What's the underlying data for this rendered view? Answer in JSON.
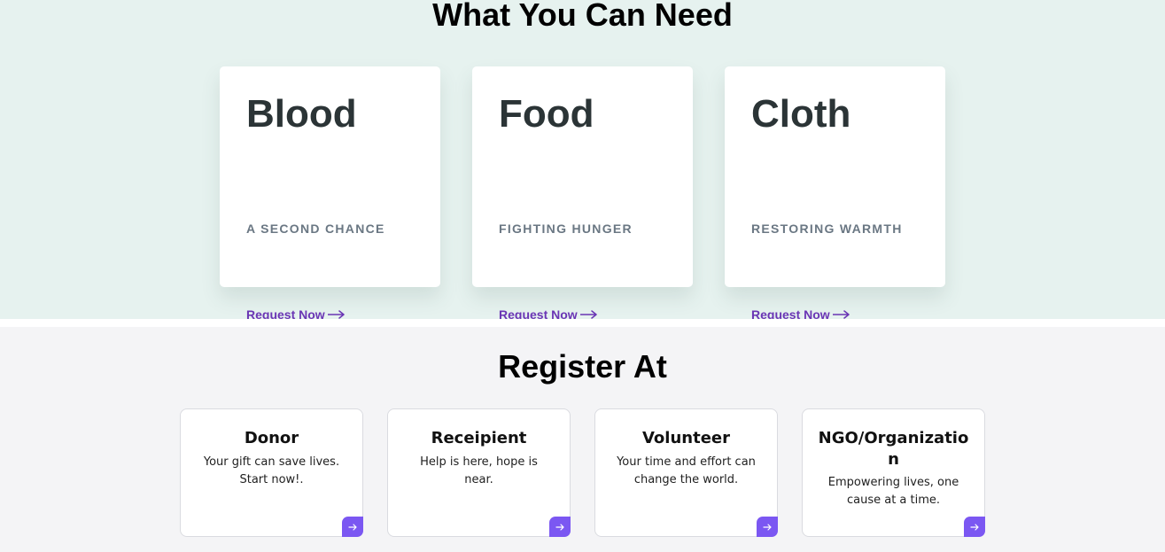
{
  "need_section": {
    "title": "What You Can Need",
    "background": "#e6f2ef",
    "cards": [
      {
        "heading": "Blood",
        "subtitle": "A SECOND CHANCE",
        "link": "Request Now",
        "link_icon": "long-arrow-right-icon"
      },
      {
        "heading": "Food",
        "subtitle": "FIGHTING HUNGER",
        "link": "Request Now",
        "link_icon": "long-arrow-right-icon"
      },
      {
        "heading": "Cloth",
        "subtitle": "RESTORING WARMTH",
        "link": "Request Now",
        "link_icon": "long-arrow-right-icon"
      }
    ],
    "link_color": "#6a35b4"
  },
  "register_section": {
    "title": "Register At",
    "background": "#f4f4f6",
    "button_color": "#7b57f2",
    "cards": [
      {
        "heading": "Donor",
        "text": "Your gift can save lives. Start now!.",
        "button_icon": "arrow-right-icon"
      },
      {
        "heading": "Receipient",
        "text": "Help is here, hope is near.",
        "button_icon": "arrow-right-icon"
      },
      {
        "heading": "Volunteer",
        "text": "Your time and effort can change the world.",
        "button_icon": "arrow-right-icon"
      },
      {
        "heading": "NGO/Organization",
        "text": "Empowering lives, one cause at a time.",
        "button_icon": "arrow-right-icon"
      }
    ]
  }
}
